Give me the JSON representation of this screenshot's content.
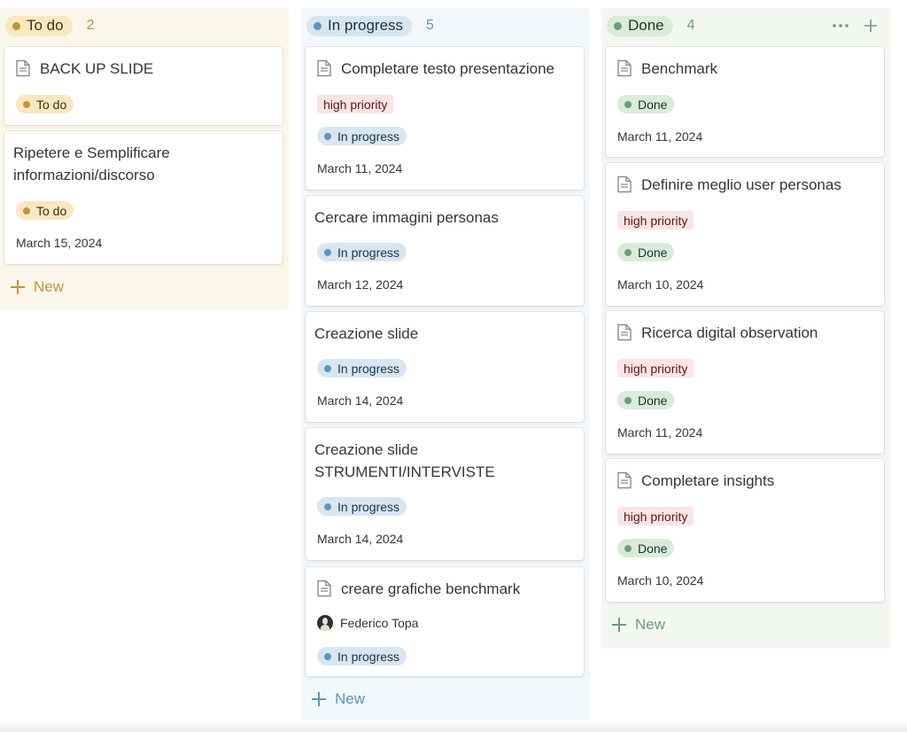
{
  "columns": {
    "todo": {
      "label": "To do",
      "count": "2",
      "new_label": "New",
      "cards": [
        {
          "title": "BACK UP SLIDE",
          "status": "To do"
        },
        {
          "title": "Ripetere e Semplificare informazioni/discorso",
          "status": "To do",
          "date": "March 15, 2024"
        }
      ]
    },
    "in_progress": {
      "label": "In progress",
      "count": "5",
      "new_label": "New",
      "cards": [
        {
          "title": "Completare testo presentazione",
          "priority": "high priority",
          "status": "In progress",
          "date": "March 11, 2024"
        },
        {
          "title": "Cercare immagini personas",
          "status": "In progress",
          "date": "March 12, 2024"
        },
        {
          "title": "Creazione slide",
          "status": "In progress",
          "date": "March 14, 2024"
        },
        {
          "title": "Creazione slide STRUMENTI/INTERVISTE",
          "status": "In progress",
          "date": "March 14, 2024"
        },
        {
          "title": "creare grafiche benchmark",
          "assignee": "Federico Topa",
          "status": "In progress"
        }
      ]
    },
    "done": {
      "label": "Done",
      "count": "4",
      "new_label": "New",
      "cards": [
        {
          "title": "Benchmark",
          "status": "Done",
          "date": "March 11, 2024"
        },
        {
          "title": "Definire meglio user personas",
          "priority": "high priority",
          "status": "Done",
          "date": "March 10, 2024"
        },
        {
          "title": "Ricerca digital observation",
          "priority": "high priority",
          "status": "Done",
          "date": "March 11, 2024"
        },
        {
          "title": "Completare insights",
          "priority": "high priority",
          "status": "Done",
          "date": "March 10, 2024"
        }
      ]
    }
  },
  "icons": {
    "page": "page-icon",
    "more": "more-horizontal-icon",
    "add": "plus-icon"
  },
  "colors": {
    "todo_accent": "#c29343",
    "progress_accent": "#5b97bd",
    "done_accent": "#6c9b7d",
    "priority_bg": "#fbe4e4"
  }
}
